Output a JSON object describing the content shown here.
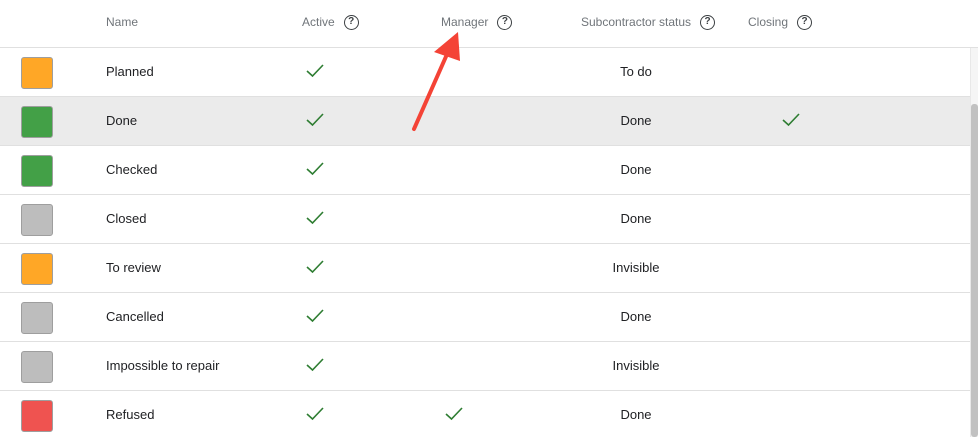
{
  "columns": {
    "name": "Name",
    "active": "Active",
    "manager": "Manager",
    "subcontractor_status": "Subcontractor status",
    "closing": "Closing"
  },
  "help_glyph": "?",
  "check_color": "#2e7d32",
  "annotation_color": "#f44336",
  "rows": [
    {
      "name": "Planned",
      "color": "#ffa726",
      "active": true,
      "manager": false,
      "subcontractor_status": "To do",
      "closing": false,
      "selected": false
    },
    {
      "name": "Done",
      "color": "#43a047",
      "active": true,
      "manager": false,
      "subcontractor_status": "Done",
      "closing": true,
      "selected": true
    },
    {
      "name": "Checked",
      "color": "#43a047",
      "active": true,
      "manager": false,
      "subcontractor_status": "Done",
      "closing": false,
      "selected": false
    },
    {
      "name": "Closed",
      "color": "#bdbdbd",
      "active": true,
      "manager": false,
      "subcontractor_status": "Done",
      "closing": false,
      "selected": false
    },
    {
      "name": "To review",
      "color": "#ffa726",
      "active": true,
      "manager": false,
      "subcontractor_status": "Invisible",
      "closing": false,
      "selected": false
    },
    {
      "name": "Cancelled",
      "color": "#bdbdbd",
      "active": true,
      "manager": false,
      "subcontractor_status": "Done",
      "closing": false,
      "selected": false
    },
    {
      "name": "Impossible to repair",
      "color": "#bdbdbd",
      "active": true,
      "manager": false,
      "subcontractor_status": "Invisible",
      "closing": false,
      "selected": false
    },
    {
      "name": "Refused",
      "color": "#ef5350",
      "active": true,
      "manager": true,
      "subcontractor_status": "Done",
      "closing": false,
      "selected": false
    }
  ]
}
